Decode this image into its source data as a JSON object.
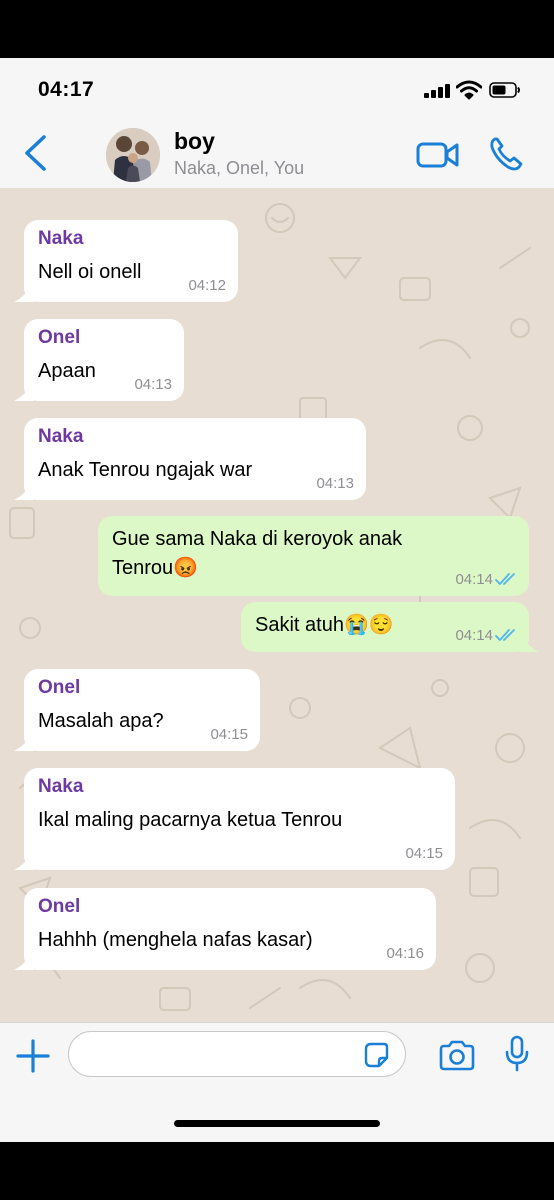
{
  "status": {
    "time": "04:17"
  },
  "header": {
    "title": "boy",
    "subtitle": "Naka, Onel, You"
  },
  "messages": [
    {
      "sender": "Naka",
      "lines": [
        "Nell oi onell"
      ],
      "time": "04:12"
    },
    {
      "sender": "Onel",
      "lines": [
        "Apaan"
      ],
      "time": "04:13"
    },
    {
      "sender": "Naka",
      "lines": [
        "Anak Tenrou ngajak war"
      ],
      "time": "04:13"
    },
    {
      "lines": [
        "Gue sama Naka di keroyok anak",
        "Tenrou😡"
      ],
      "time": "04:14",
      "status": "read"
    },
    {
      "lines": [
        "Sakit atuh😭😌"
      ],
      "time": "04:14",
      "status": "read"
    },
    {
      "sender": "Onel",
      "lines": [
        "Masalah apa?"
      ],
      "time": "04:15"
    },
    {
      "sender": "Naka",
      "lines": [
        "Ikal maling pacarnya ketua Tenrou"
      ],
      "time": "04:15"
    },
    {
      "sender": "Onel",
      "lines": [
        "Hahhh (menghela nafas kasar)"
      ],
      "time": "04:16"
    }
  ],
  "composer": {
    "value": "",
    "placeholder": ""
  },
  "icons": {
    "back": "chevron-left-icon",
    "video": "video-camera-icon",
    "call": "phone-icon",
    "add": "plus-icon",
    "sticker": "sticker-icon",
    "camera": "camera-icon",
    "mic": "microphone-icon"
  },
  "colors": {
    "accent": "#1a7fd6",
    "incoming_bubble": "#ffffff",
    "outgoing_bubble": "#dcf8c6",
    "sender_name": "#6e3aa0",
    "read_ticks": "#4fb6ec",
    "wallpaper": "#e7ddd2"
  }
}
